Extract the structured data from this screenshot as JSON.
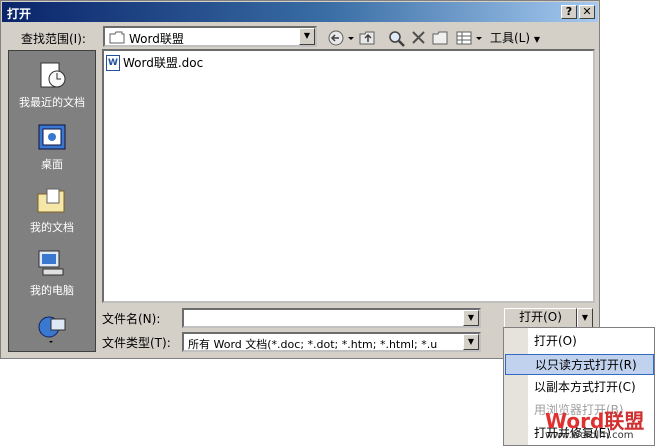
{
  "window": {
    "title": "打开",
    "help_label": "?",
    "close_label": "✕"
  },
  "lookin": {
    "label": "查找范围(I):",
    "value": "Word联盟"
  },
  "toolbar": {
    "tools_label": "工具(L)"
  },
  "places": [
    {
      "label": "我最近的文档"
    },
    {
      "label": "桌面"
    },
    {
      "label": "我的文档"
    },
    {
      "label": "我的电脑"
    }
  ],
  "files": [
    {
      "name": "Word联盟.doc"
    }
  ],
  "filename": {
    "label": "文件名(N):",
    "value": ""
  },
  "filetype": {
    "label": "文件类型(T):",
    "value": "所有 Word 文档(*.doc; *.dot; *.htm; *.html; *.u"
  },
  "open_button": {
    "label": "打开(O)"
  },
  "menu": {
    "items": [
      {
        "label": "打开(O)",
        "state": "normal"
      },
      {
        "label": "以只读方式打开(R)",
        "state": "selected"
      },
      {
        "label": "以副本方式打开(C)",
        "state": "normal"
      },
      {
        "label": "用浏览器打开(B)",
        "state": "disabled"
      },
      {
        "label": "打开并修复(E)",
        "state": "normal"
      }
    ]
  },
  "watermark": {
    "brand_word": "Word",
    "brand_cn": "联盟",
    "url": "www.wordlm.com"
  },
  "colors": {
    "title_start": "#0a246a",
    "selection": "#c1d2ee",
    "face": "#d4d0c8"
  }
}
